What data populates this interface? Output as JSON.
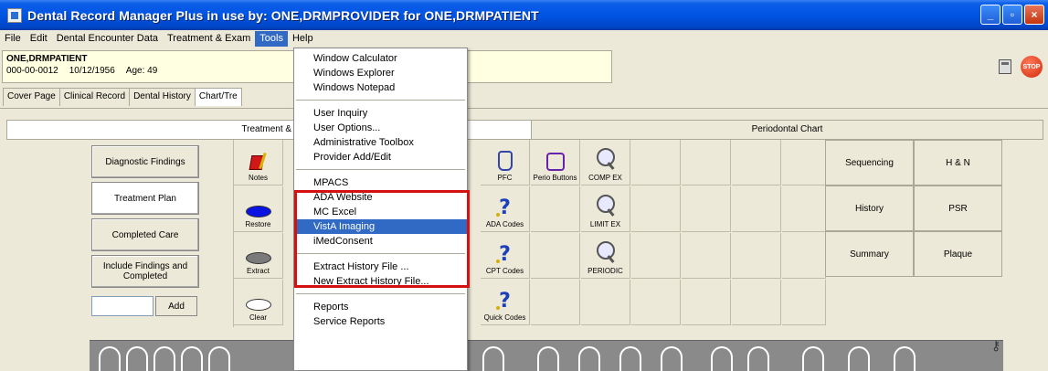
{
  "window": {
    "title": "Dental Record Manager Plus in use by: ONE,DRMPROVIDER for ONE,DRMPATIENT"
  },
  "menubar": {
    "items": [
      "File",
      "Edit",
      "Dental Encounter Data",
      "Treatment & Exam",
      "Tools",
      "Help"
    ],
    "active": "Tools"
  },
  "patient": {
    "name": "ONE,DRMPATIENT",
    "id": "000-00-0012",
    "dob": "10/12/1956",
    "age": "Age: 49"
  },
  "tabs": [
    "Cover Page",
    "Clinical Record",
    "Dental History",
    "Chart/Tre"
  ],
  "panel": {
    "left_header": "Treatment & I",
    "right_header": "Periodontal Chart"
  },
  "left_buttons": [
    "Diagnostic Findings",
    "Treatment Plan",
    "Completed Care",
    "Include Findings and Completed"
  ],
  "add_button": "Add",
  "tool_cells": {
    "notes": "Notes",
    "restore": "Restore",
    "extract": "Extract",
    "clear": "Clear",
    "pfc": "PFC",
    "ada_codes": "ADA Codes",
    "cpt_codes": "CPT Codes",
    "quick_codes": "Quick Codes",
    "perio_buttons": "Perio Buttons",
    "comp_ex": "COMP EX",
    "limit_ex": "LIMIT EX",
    "periodic": "PERIODIC"
  },
  "right_buttons": [
    "Sequencing",
    "H & N",
    "History",
    "PSR",
    "Summary",
    "Plaque"
  ],
  "tools_menu": {
    "group1": [
      "Window Calculator",
      "Windows Explorer",
      "Windows Notepad"
    ],
    "group2": [
      "User Inquiry",
      "User Options...",
      "Administrative Toolbox",
      "Provider Add/Edit"
    ],
    "group3": [
      "MPACS",
      "ADA Website",
      "MC Excel",
      "VistA Imaging",
      "iMedConsent"
    ],
    "group4": [
      "Extract History File ...",
      "New Extract History File..."
    ],
    "group5": [
      "Reports",
      "Service Reports"
    ],
    "highlighted": "VistA Imaging"
  },
  "colors": {
    "titlebar": "#0054e3",
    "selection": "#316ac5",
    "annotation_box": "#d41010",
    "restore_oval": "#0a14e0",
    "extract_oval": "#7a7a7a"
  }
}
